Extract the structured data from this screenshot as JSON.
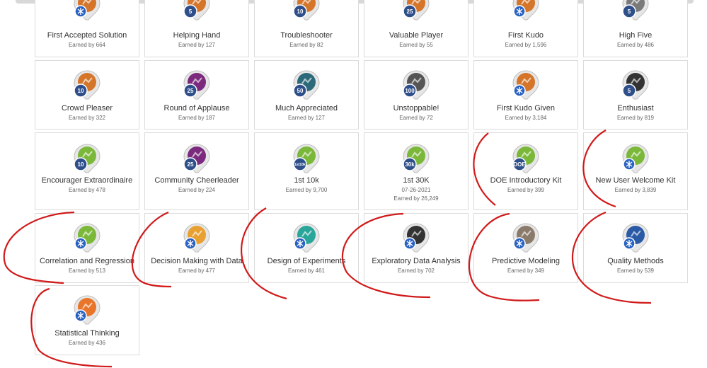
{
  "badges": [
    {
      "name": "First Accepted Solution",
      "earned": "Earned by 664",
      "color": "#d4752a",
      "level": ""
    },
    {
      "name": "Helping Hand",
      "earned": "Earned by 127",
      "color": "#d4752a",
      "level": "5"
    },
    {
      "name": "Troubleshooter",
      "earned": "Earned by 82",
      "color": "#d4752a",
      "level": "10"
    },
    {
      "name": "Valuable Player",
      "earned": "Earned by 55",
      "color": "#d4752a",
      "level": "25"
    },
    {
      "name": "First Kudo",
      "earned": "Earned by 1,596",
      "color": "#d4752a",
      "level": ""
    },
    {
      "name": "High Five",
      "earned": "Earned by 486",
      "color": "#7a7a7a",
      "level": "5"
    },
    {
      "name": "Crowd Pleaser",
      "earned": "Earned by 322",
      "color": "#d4752a",
      "level": "10"
    },
    {
      "name": "Round of Applause",
      "earned": "Earned by 187",
      "color": "#7b2a7d",
      "level": "25"
    },
    {
      "name": "Much Appreciated",
      "earned": "Earned by 127",
      "color": "#2c6a7a",
      "level": "50"
    },
    {
      "name": "Unstoppable!",
      "earned": "Earned by 72",
      "color": "#555555",
      "level": "100"
    },
    {
      "name": "First Kudo Given",
      "earned": "Earned by 3,184",
      "color": "#d4752a",
      "level": ""
    },
    {
      "name": "Enthusiast",
      "earned": "Earned by 819",
      "color": "#333333",
      "level": "5"
    },
    {
      "name": "Encourager Extraordinaire",
      "earned": "Earned by 478",
      "color": "#7bb83a",
      "level": "10"
    },
    {
      "name": "Community Cheerleader",
      "earned": "Earned by 224",
      "color": "#7b2a7d",
      "level": "25"
    },
    {
      "name": "1st 10k",
      "earned": "Earned by 9,700",
      "color": "#7bb83a",
      "level": "1st 10k"
    },
    {
      "name": "1st 30K",
      "date": "07-26-2021",
      "earned": "Earned by 26,249",
      "color": "#7bb83a",
      "level": "30k"
    },
    {
      "name": "DOE Introductory Kit",
      "earned": "Earned by 399",
      "color": "#7bb83a",
      "level": "DOE"
    },
    {
      "name": "New User Welcome Kit",
      "earned": "Earned by 3,839",
      "color": "#7bb83a",
      "level": ""
    },
    {
      "name": "Correlation and Regression",
      "earned": "Earned by 513",
      "color": "#7bb83a",
      "level": ""
    },
    {
      "name": "Decision Making with Data",
      "earned": "Earned by 477",
      "color": "#e8a030",
      "level": ""
    },
    {
      "name": "Design of Experiments",
      "earned": "Earned by 461",
      "color": "#2aa59a",
      "level": ""
    },
    {
      "name": "Exploratory Data Analysis",
      "earned": "Earned by 702",
      "color": "#333333",
      "level": ""
    },
    {
      "name": "Predictive Modeling",
      "earned": "Earned by 349",
      "color": "#8a7a6a",
      "level": ""
    },
    {
      "name": "Quality Methods",
      "earned": "Earned by 539",
      "color": "#2a5aa5",
      "level": ""
    },
    {
      "name": "Statistical Thinking",
      "earned": "Earned by 436",
      "color": "#e8752a",
      "level": ""
    }
  ],
  "annotation_color": "#d11a1a"
}
